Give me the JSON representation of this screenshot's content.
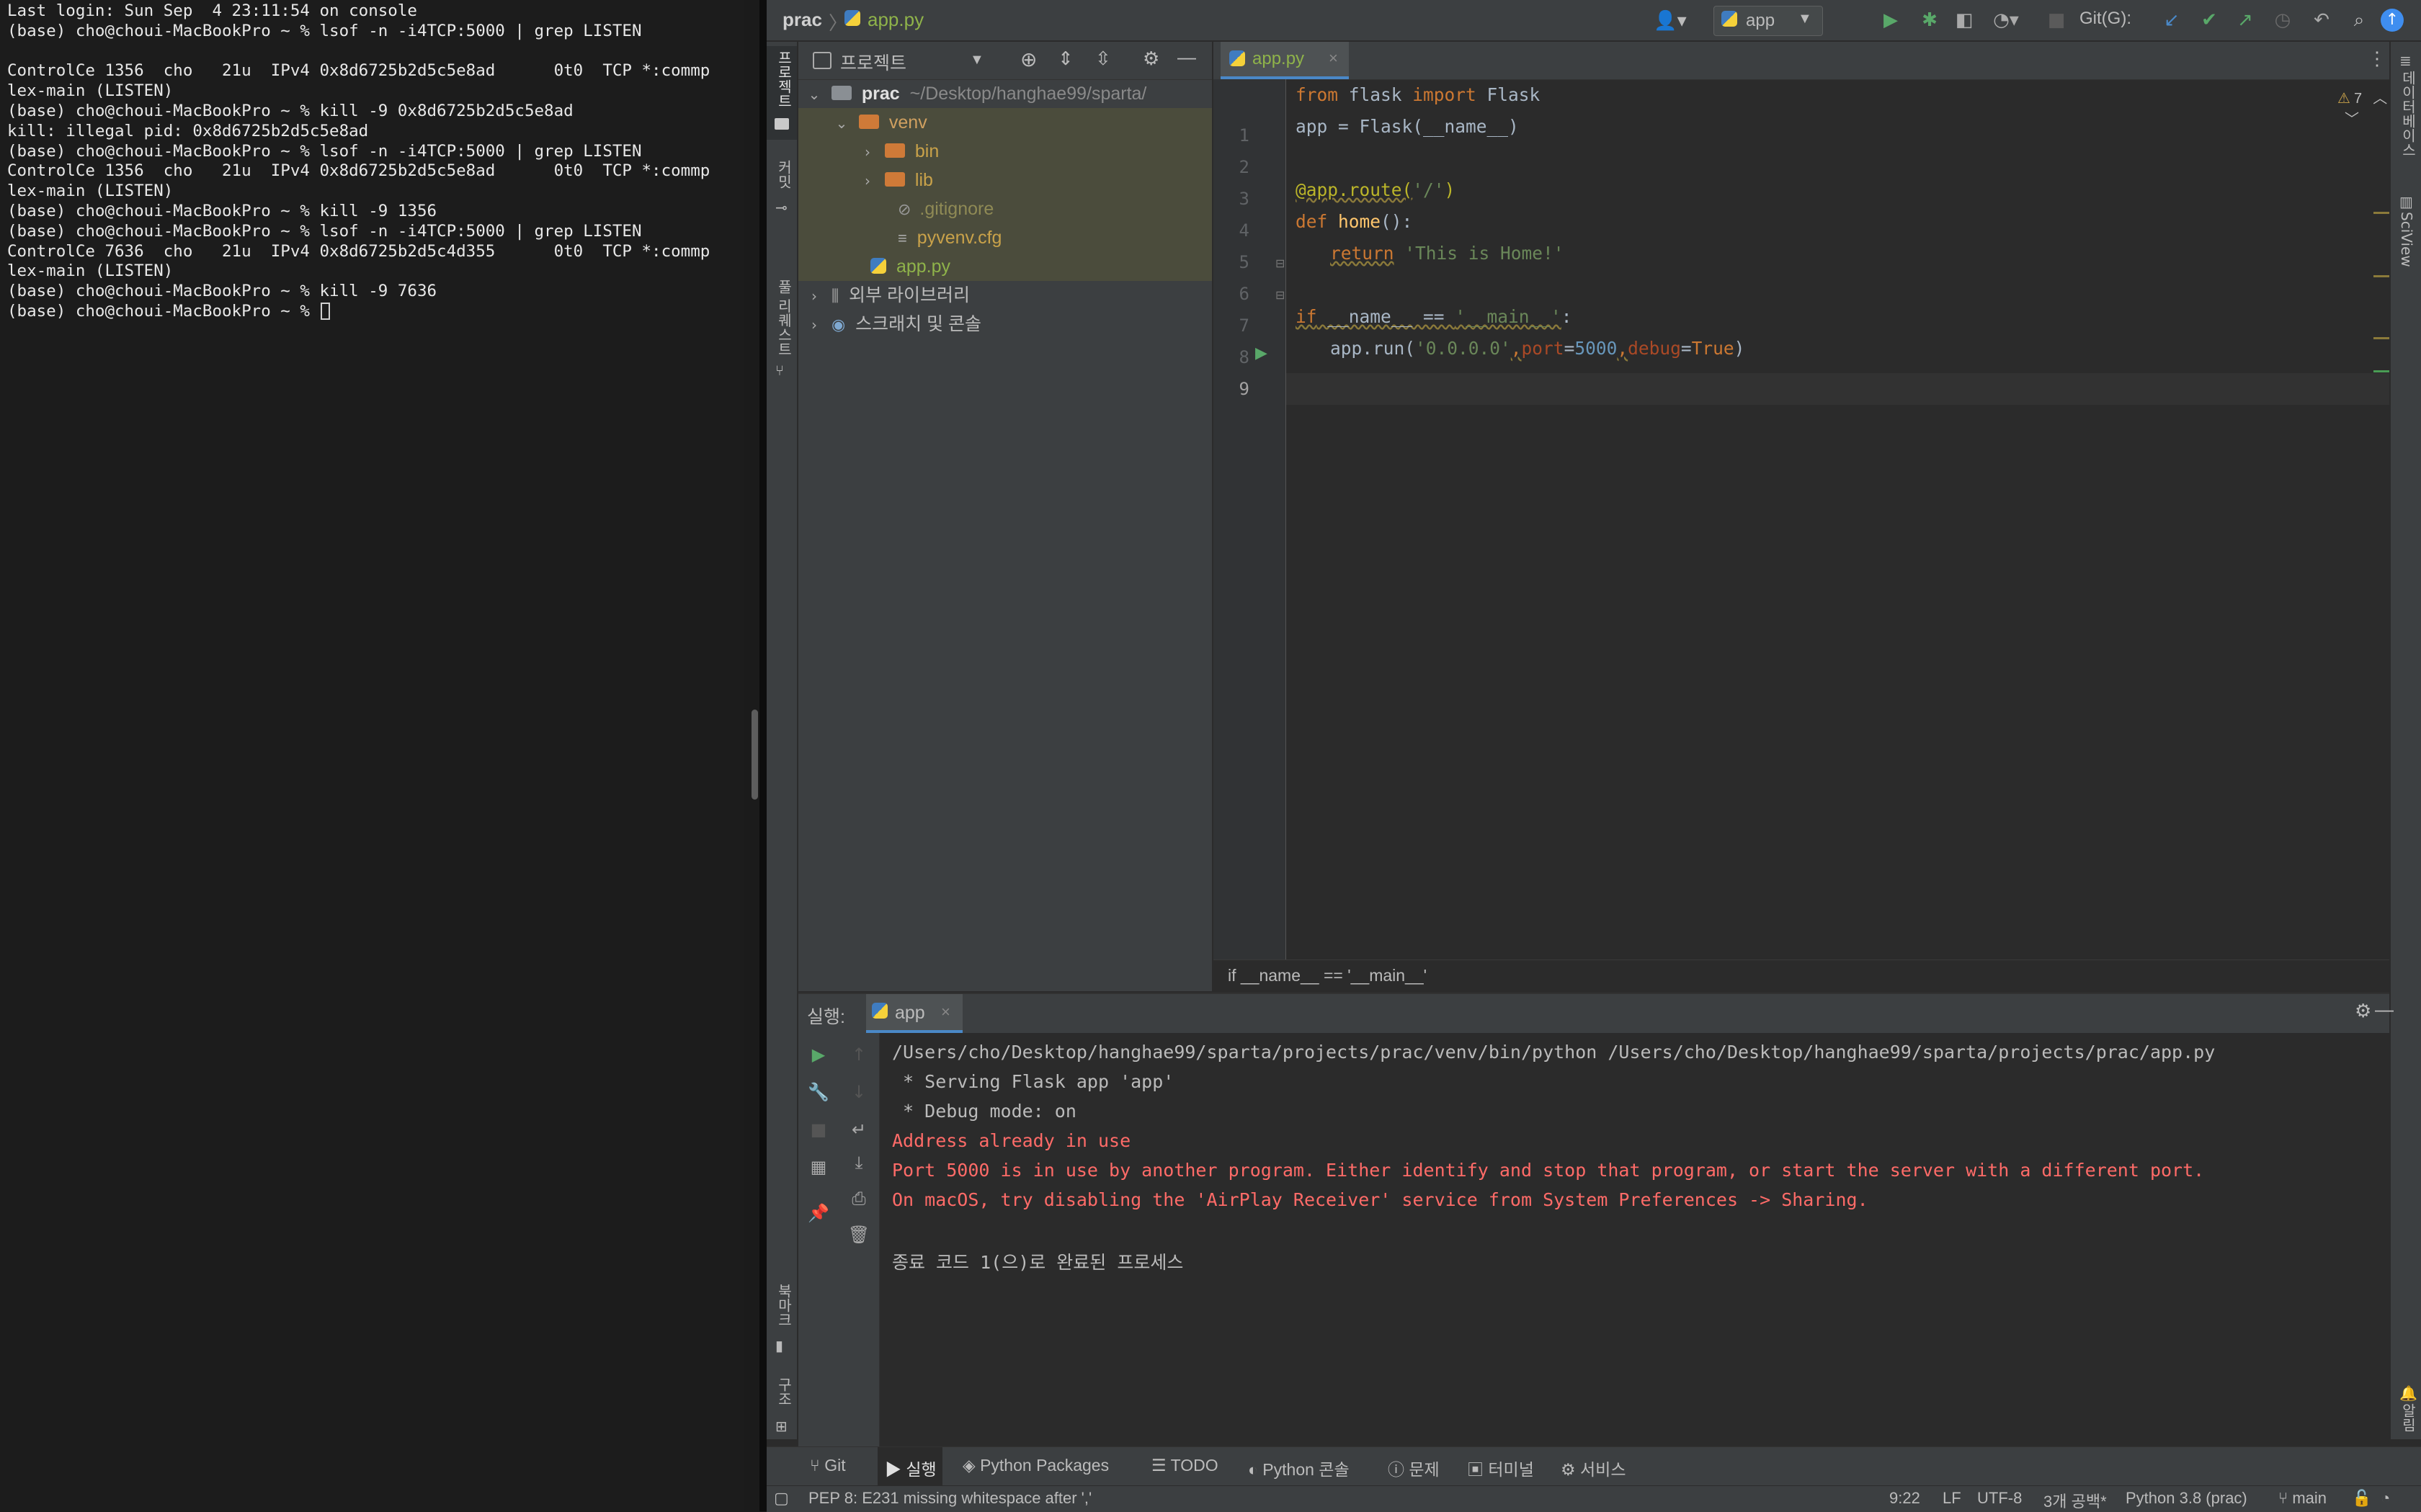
{
  "colors": {
    "accent": "#4a88c7",
    "error_text": "#ff6b68",
    "keyword": "#cc7832",
    "string": "#6a8759",
    "folder": "#cf7a38"
  },
  "terminal": {
    "lines": [
      "Last login: Sun Sep  4 23:11:54 on console",
      "(base) cho@choui-MacBookPro ~ % lsof -n -i4TCP:5000 | grep LISTEN",
      "",
      "ControlCe 1356  cho   21u  IPv4 0x8d6725b2d5c5e8ad      0t0  TCP *:commp",
      "lex-main (LISTEN)",
      "(base) cho@choui-MacBookPro ~ % kill -9 0x8d6725b2d5c5e8ad",
      "kill: illegal pid: 0x8d6725b2d5c5e8ad",
      "(base) cho@choui-MacBookPro ~ % lsof -n -i4TCP:5000 | grep LISTEN",
      "ControlCe 1356  cho   21u  IPv4 0x8d6725b2d5c5e8ad      0t0  TCP *:commp",
      "lex-main (LISTEN)",
      "(base) cho@choui-MacBookPro ~ % kill -9 1356",
      "(base) cho@choui-MacBookPro ~ % lsof -n -i4TCP:5000 | grep LISTEN",
      "ControlCe 7636  cho   21u  IPv4 0x8d6725b2d5c4d355      0t0  TCP *:commp",
      "lex-main (LISTEN)",
      "(base) cho@choui-MacBookPro ~ % kill -9 7636",
      "(base) cho@choui-MacBookPro ~ % "
    ]
  },
  "ide": {
    "breadcrumb": {
      "project": "prac",
      "file": "app.py"
    },
    "run_config": "app",
    "git_label": "Git(G):",
    "left_strip": {
      "project": "프로젝트",
      "commit": "커밋",
      "pull_requests": "풀 리퀘스트",
      "bookmarks": "북마크",
      "structure": "구조"
    },
    "right_strip": {
      "database": "데이터베이스",
      "sciview": "SciView",
      "notifications": "알림"
    },
    "project_panel": {
      "title": "프로젝트",
      "root_name": "prac",
      "root_path": "~/Desktop/hanghae99/sparta/",
      "venv": "venv",
      "bin": "bin",
      "lib": "lib",
      "gitignore": ".gitignore",
      "pyvenv": "pyvenv.cfg",
      "app_file": "app.py",
      "external_libs": "외부 라이브러리",
      "scratches": "스크래치 및 콘솔"
    },
    "editor": {
      "tab": "app.py",
      "warnings": "7",
      "footer_breadcrumb": "if __name__ == '__main__'",
      "line_numbers": [
        "1",
        "2",
        "3",
        "4",
        "5",
        "6",
        "7",
        "8",
        "9"
      ],
      "code": {
        "l1": {
          "from": "from",
          "mod": " flask ",
          "imp": "import",
          "name": " Flask"
        },
        "l2": "app = Flask(__name__)",
        "l4": {
          "dec": "@app.route(",
          "arg": "'/'",
          "close": ")"
        },
        "l5": {
          "kw": "def",
          "fn": " home",
          "rest": "():"
        },
        "l6": {
          "kw": "return",
          "str": " 'This is Home!'"
        },
        "l8": {
          "kw": "if",
          "mid": " __name__ == ",
          "str": "'__main__'",
          "end": ":"
        },
        "l9": {
          "a": "app.run(",
          "host": "'0.0.0.0'",
          "c1": ",",
          "p": "port",
          "e1": "=",
          "pv": "5000",
          "c2": ",",
          "d": "debug",
          "e2": "=",
          "dv": "True",
          "end": ")"
        }
      }
    },
    "run": {
      "label": "실행:",
      "tab": "app",
      "output": [
        {
          "text": "/Users/cho/Desktop/hanghae99/sparta/projects/prac/venv/bin/python /Users/cho/Desktop/hanghae99/sparta/projects/prac/app.py",
          "error": false
        },
        {
          "text": " * Serving Flask app 'app'",
          "error": false
        },
        {
          "text": " * Debug mode: on",
          "error": false
        },
        {
          "text": "Address already in use",
          "error": true
        },
        {
          "text": "Port 5000 is in use by another program. Either identify and stop that program, or start the server with a different port.",
          "error": true
        },
        {
          "text": "On macOS, try disabling the 'AirPlay Receiver' service from System Preferences -> Sharing.",
          "error": true
        },
        {
          "text": "",
          "error": false
        },
        {
          "text": "종료 코드 1(으)로 완료된 프로세스",
          "error": false
        }
      ]
    },
    "bottom_tabs": [
      "Git",
      "실행",
      "Python Packages",
      "TODO",
      "Python 콘솔",
      "문제",
      "터미널",
      "서비스"
    ],
    "status": {
      "message": "PEP 8: E231 missing whitespace after ','",
      "position": "9:22",
      "line_sep": "LF",
      "encoding": "UTF-8",
      "indent": "3개 공백*",
      "interpreter": "Python 3.8 (prac)",
      "branch": "main"
    }
  }
}
